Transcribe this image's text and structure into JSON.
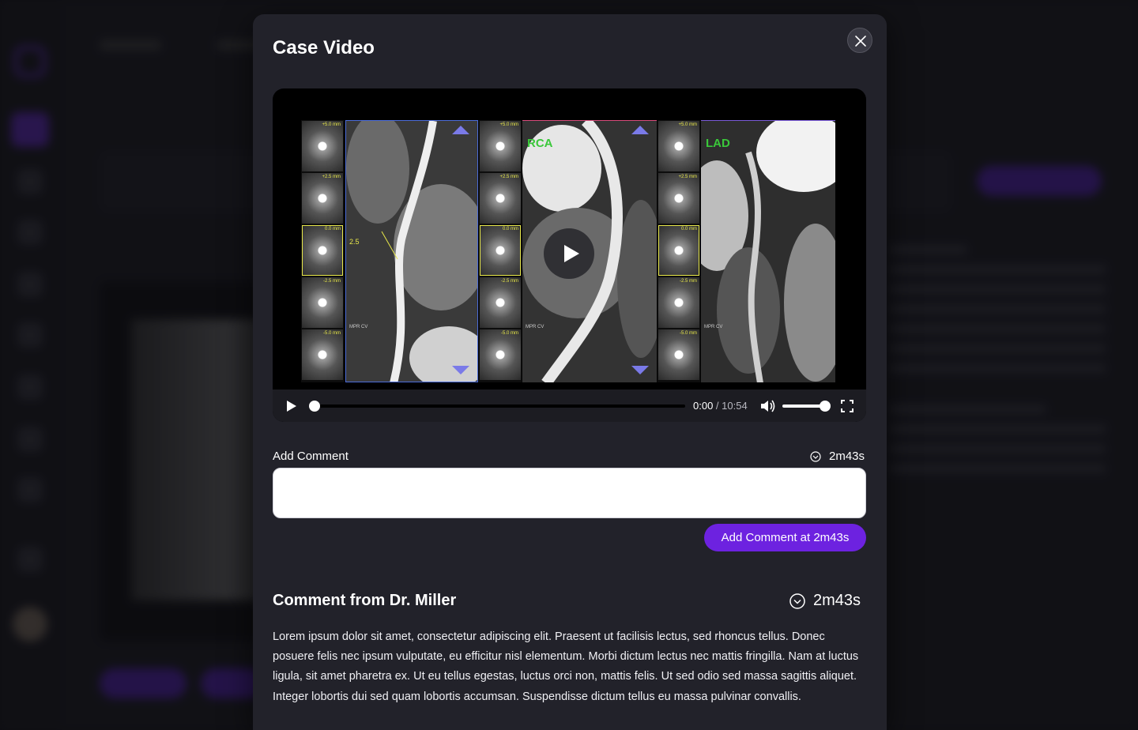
{
  "modal": {
    "title": "Case Video",
    "close_icon": "close-icon"
  },
  "video": {
    "panels": [
      {
        "label": "",
        "slice_labels": [
          "+5.0 mm",
          "+2.5 mm",
          "0.0 mm",
          "-2.5 mm",
          "-5.0 mm"
        ],
        "mpr_label": "MPR CV",
        "measure_label": "2.5"
      },
      {
        "label": "RCA",
        "slice_labels": [
          "+5.0 mm",
          "+2.5 mm",
          "0.0 mm",
          "-2.5 mm",
          "-5.0 mm"
        ],
        "mpr_label": "MPR CV"
      },
      {
        "label": "LAD",
        "slice_labels": [
          "+5.0 mm",
          "+2.5 mm",
          "0.0 mm",
          "-2.5 mm",
          "-5.0 mm"
        ],
        "mpr_label": "MPR CV"
      }
    ],
    "progress": 0,
    "volume": 0.9,
    "controls": {
      "current_time": "0:00",
      "duration": "10:54",
      "play_icon": "play-icon",
      "volume_icon": "volume-icon",
      "fullscreen_icon": "fullscreen-icon"
    }
  },
  "add_comment": {
    "label": "Add Comment",
    "timestamp": "2m43s",
    "timestamp_icon": "clock-icon",
    "value": "",
    "placeholder": "",
    "button_label": "Add Comment at 2m43s"
  },
  "comment": {
    "heading": "Comment from Dr. Miller",
    "timestamp": "2m43s",
    "timestamp_icon": "clock-icon",
    "body": "Lorem ipsum dolor sit amet, consectetur adipiscing elit. Praesent ut facilisis lectus, sed rhoncus tellus. Donec posuere felis nec ipsum vulputate, eu efficitur nisl elementum. Morbi dictum lectus nec mattis fringilla. Nam at luctus ligula, sit amet pharetra ex. Ut eu tellus egestas, luctus orci non, mattis felis. Ut sed odio sed massa sagittis aliquet. Integer lobortis dui sed quam lobortis accumsan. Suspendisse dictum tellus eu massa pulvinar convallis."
  },
  "colors": {
    "accent": "#6d22e0",
    "modal_bg": "#22222a",
    "vessel_label": "#3ac83a"
  }
}
